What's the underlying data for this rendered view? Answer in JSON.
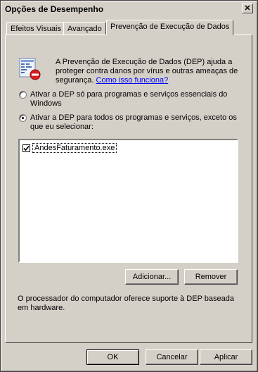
{
  "window": {
    "title": "Opções de Desempenho",
    "close_glyph": "✕"
  },
  "tabs": [
    {
      "label": "Efeitos Visuais",
      "active": false
    },
    {
      "label": "Avançado",
      "active": false
    },
    {
      "label": "Prevenção de Execução de Dados",
      "active": true
    }
  ],
  "dep": {
    "icon": "dep-shield-icon",
    "description": "A Prevenção de Execução de Dados (DEP) ajuda a proteger contra danos por vírus e outras ameaças de segurança.",
    "help_link": "Como isso funciona?",
    "options": [
      {
        "label_line1": "Ativar a DEP só para programas e serviços essenciais do",
        "label_line2": "Windows",
        "selected": false
      },
      {
        "label_line1": "Ativar a DEP para todos os programas e serviços, exceto os",
        "label_line2": "que eu selecionar:",
        "selected": true
      }
    ],
    "exceptions": [
      {
        "name": "AndesFaturamento.exe",
        "checked": true
      }
    ],
    "add_button": "Adicionar...",
    "remove_button": "Remover",
    "hardware_note": "O processador do computador oferece suporte à DEP baseada em hardware."
  },
  "footer": {
    "ok": "OK",
    "cancel": "Cancelar",
    "apply": "Aplicar"
  }
}
